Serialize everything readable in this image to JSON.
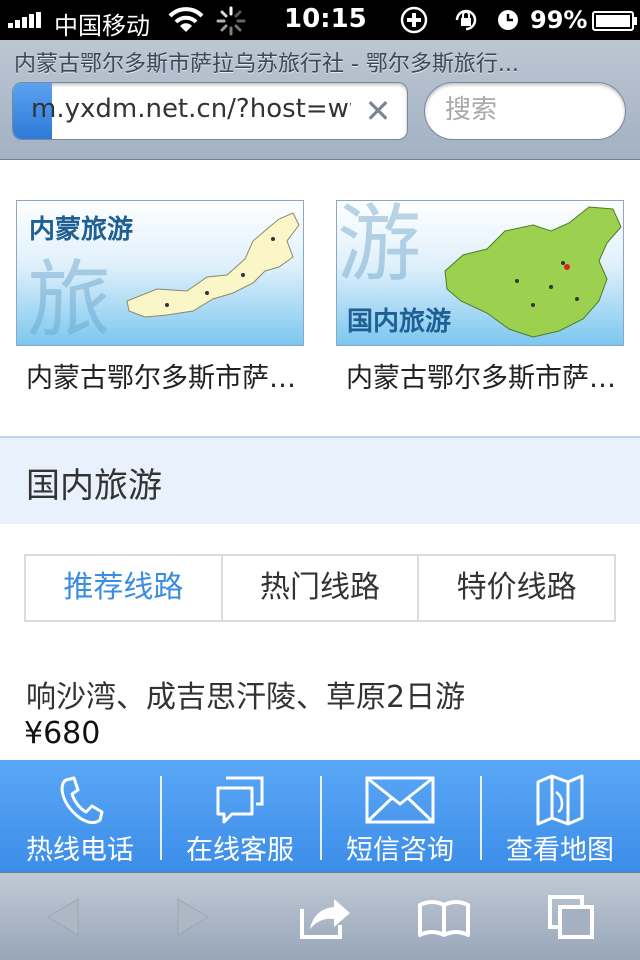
{
  "status_bar": {
    "carrier": "中国移动",
    "time": "10:15",
    "battery_percent": "99%",
    "battery_level": 0.99,
    "icons": [
      "signal-icon",
      "wifi-icon",
      "loading-spinner-icon",
      "plus-circle-icon",
      "rotation-lock-icon",
      "alarm-icon",
      "battery-charging-icon"
    ]
  },
  "browser": {
    "page_title": "内蒙古鄂尔多斯市萨拉乌苏旅行社 - 鄂尔多斯旅行...",
    "url": "m.yxdm.net.cn/?host=www",
    "load_progress": 0.1,
    "search_placeholder": "搜索",
    "clear_icon": "close-icon"
  },
  "featured": [
    {
      "image_text": "内蒙旅游",
      "image_glyph": "旅",
      "caption": "内蒙古鄂尔多斯市萨拉乌苏旅行社"
    },
    {
      "image_text": "国内旅游",
      "image_glyph": "游",
      "caption": "内蒙古鄂尔多斯市萨拉乌苏旅行社"
    }
  ],
  "section": {
    "heading": "国内旅游"
  },
  "tabs": [
    {
      "label": "推荐线路",
      "active": true
    },
    {
      "label": "热门线路",
      "active": false
    },
    {
      "label": "特价线路",
      "active": false
    }
  ],
  "route": {
    "title": "响沙湾、成吉思汗陵、草原2日游",
    "price": "¥680"
  },
  "contact_bar": [
    {
      "label": "热线电话",
      "icon": "phone-icon"
    },
    {
      "label": "在线客服",
      "icon": "chat-icon"
    },
    {
      "label": "短信咨询",
      "icon": "envelope-icon"
    },
    {
      "label": "查看地图",
      "icon": "map-icon"
    }
  ],
  "toolbar": {
    "icons": [
      "back-arrow-icon",
      "forward-arrow-icon",
      "share-icon",
      "bookmarks-icon",
      "tabs-icon"
    ]
  },
  "colors": {
    "accent": "#3b8de2",
    "contact_bar": "#4a9af0",
    "section_bg": "#e9f2fc"
  }
}
